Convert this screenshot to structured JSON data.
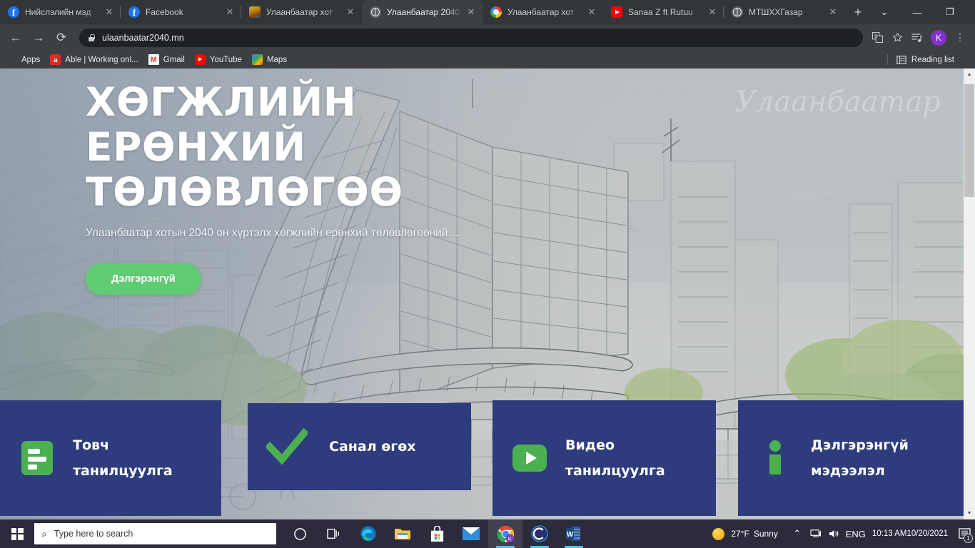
{
  "browser": {
    "tabs": [
      {
        "title": "Нийслэлийн мэд",
        "icon": "facebook-icon",
        "active": false
      },
      {
        "title": "Facebook",
        "icon": "facebook-icon",
        "active": false
      },
      {
        "title": "Улаанбаатар хот",
        "icon": "crest-icon",
        "active": false
      },
      {
        "title": "Улаанбаатар 2040",
        "icon": "globe-icon",
        "active": true
      },
      {
        "title": "Улаанбаатар хот",
        "icon": "google-icon",
        "active": false
      },
      {
        "title": "Sanaa Z ft Rutuu",
        "icon": "youtube-icon",
        "active": false
      },
      {
        "title": "МТШХХГазар",
        "icon": "globe-icon",
        "active": false
      }
    ],
    "new_tab_label": "+",
    "close_label": "✕",
    "window_controls": {
      "minimize": "—",
      "restore": "❐",
      "close": "✕",
      "more": "⌄"
    },
    "nav": {
      "back": "←",
      "forward": "→",
      "reload": "⟳"
    },
    "omnibox": {
      "url": "ulaanbaatar2040.mn",
      "lock_icon": "lock-icon"
    },
    "toolbar_icons": {
      "translate": "translate-icon",
      "bookmark_star": "star-icon",
      "media": "media-icon",
      "profile_initial": "K",
      "menu": "⋮"
    },
    "bookmarks": [
      {
        "label": "Apps",
        "icon": "apps-grid-icon"
      },
      {
        "label": "Able | Working onl...",
        "icon": "able-icon"
      },
      {
        "label": "Gmail",
        "icon": "gmail-icon"
      },
      {
        "label": "YouTube",
        "icon": "youtube-icon"
      },
      {
        "label": "Maps",
        "icon": "maps-icon"
      }
    ],
    "reading_list": {
      "label": "Reading list",
      "icon": "reading-list-icon"
    }
  },
  "page": {
    "hero": {
      "title_lines": [
        "ХӨГЖЛИЙН",
        "ЕРӨНХИЙ",
        "ТӨЛӨВЛӨГӨӨ"
      ],
      "subtitle": "Улаанбаатар хотын 2040 он хүртэлх хөгжлийн ерөнхий төлөвлөгөөний…",
      "cta_label": "Дэлгэрэнгүй",
      "watermark": "Улаанбаатар"
    },
    "cards": [
      {
        "label_lines": [
          "Товч",
          "танилцуулга"
        ],
        "icon": "document-lines-icon"
      },
      {
        "label_lines": [
          "Санал өгөх"
        ],
        "icon": "check-icon"
      },
      {
        "label_lines": [
          "Видео",
          "танилцуулга"
        ],
        "icon": "play-icon"
      },
      {
        "label_lines": [
          "Дэлгэрэнгүй",
          "мэдээлэл"
        ],
        "icon": "info-icon"
      }
    ],
    "colors": {
      "card_bg": "#2e3c7e",
      "accent_green": "#4caf50",
      "cta_green": "#5fcb73"
    },
    "scrollbar": {
      "up_arrow": "▲",
      "down_arrow": "▼"
    }
  },
  "taskbar": {
    "start": "windows-logo-icon",
    "search_placeholder": "Type here to search",
    "search_icon": "search-icon",
    "items": [
      {
        "name": "cortana-icon"
      },
      {
        "name": "task-view-icon"
      },
      {
        "name": "edge-icon"
      },
      {
        "name": "file-explorer-icon"
      },
      {
        "name": "microsoft-store-icon"
      },
      {
        "name": "mail-icon"
      },
      {
        "name": "chrome-icon"
      },
      {
        "name": "c-app-icon"
      },
      {
        "name": "word-icon"
      }
    ],
    "weather": {
      "temp": "27°F",
      "condition": "Sunny",
      "icon": "sun-icon"
    },
    "tray": {
      "chevron": "⌃",
      "network": "network-icon",
      "volume": "volume-icon",
      "language": "ENG"
    },
    "clock": {
      "time": "10:13 AM",
      "date": "10/20/2021"
    },
    "notifications": {
      "icon": "notification-icon",
      "count": "1"
    }
  }
}
